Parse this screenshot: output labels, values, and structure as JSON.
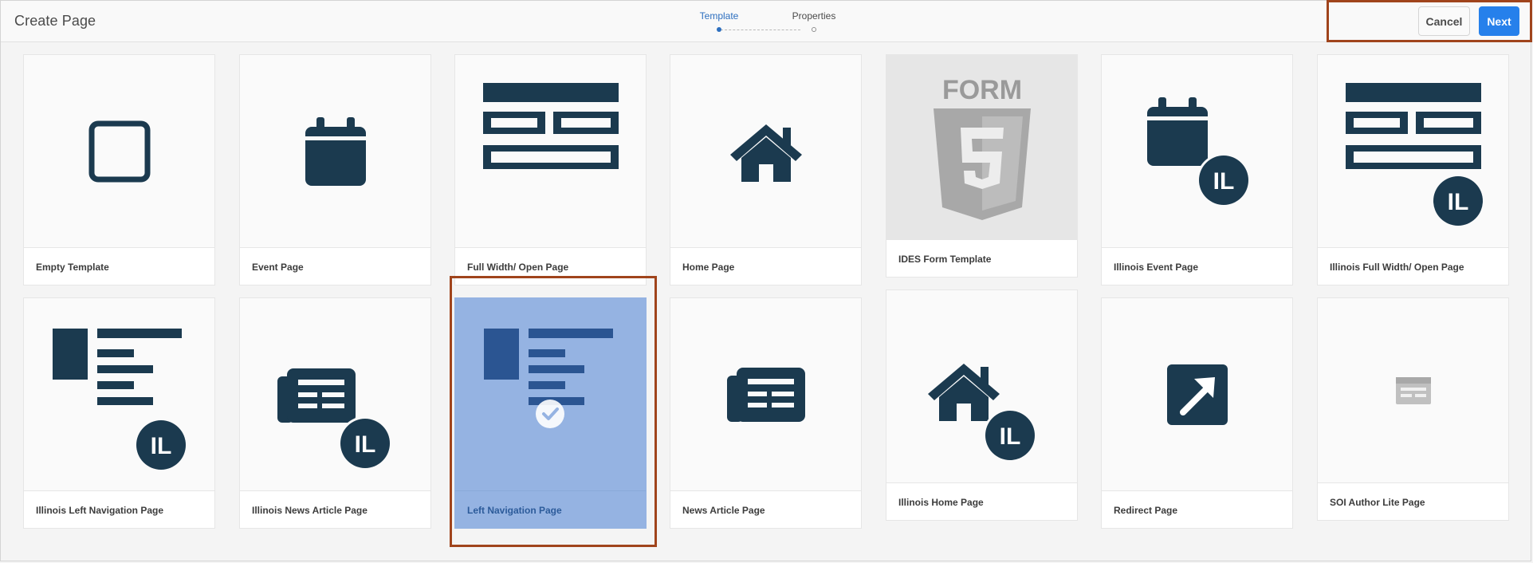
{
  "header": {
    "title": "Create Page",
    "steps": [
      {
        "label": "Template",
        "state": "active"
      },
      {
        "label": "Properties",
        "state": "inactive"
      }
    ],
    "buttons": {
      "cancel": "Cancel",
      "next": "Next"
    }
  },
  "colors": {
    "icon": "#1b3a4f",
    "selection_fill": "#95b3e2",
    "primary_button": "#2680eb",
    "highlight_outline": "#a0441c",
    "active_step": "#2d6fbf"
  },
  "templates": [
    {
      "label": "Empty Template",
      "icon": "square-outline-icon"
    },
    {
      "label": "Event Page",
      "icon": "calendar-icon"
    },
    {
      "label": "Full Width/ Open Page",
      "icon": "full-width-layout-icon"
    },
    {
      "label": "Home Page",
      "icon": "home-icon"
    },
    {
      "label": "IDES Form Template",
      "icon": "form-html5-icon"
    },
    {
      "label": "Illinois Event Page",
      "icon": "calendar-il-icon",
      "badge": "IL"
    },
    {
      "label": "Illinois Full Width/ Open Page",
      "icon": "full-width-layout-il-icon",
      "badge": "IL"
    },
    {
      "label": "Illinois Left Navigation Page",
      "icon": "left-nav-layout-il-icon",
      "badge": "IL"
    },
    {
      "label": "Illinois News Article Page",
      "icon": "newspaper-il-icon",
      "badge": "IL"
    },
    {
      "label": "Left Navigation Page",
      "icon": "left-nav-layout-icon",
      "selected": true
    },
    {
      "label": "News Article Page",
      "icon": "newspaper-icon"
    },
    {
      "label": "Illinois Home Page",
      "icon": "home-il-icon",
      "badge": "IL"
    },
    {
      "label": "Redirect Page",
      "icon": "redirect-arrow-icon"
    },
    {
      "label": "SOI Author Lite Page",
      "icon": "document-small-icon"
    }
  ],
  "form_icon_text": "FORM"
}
